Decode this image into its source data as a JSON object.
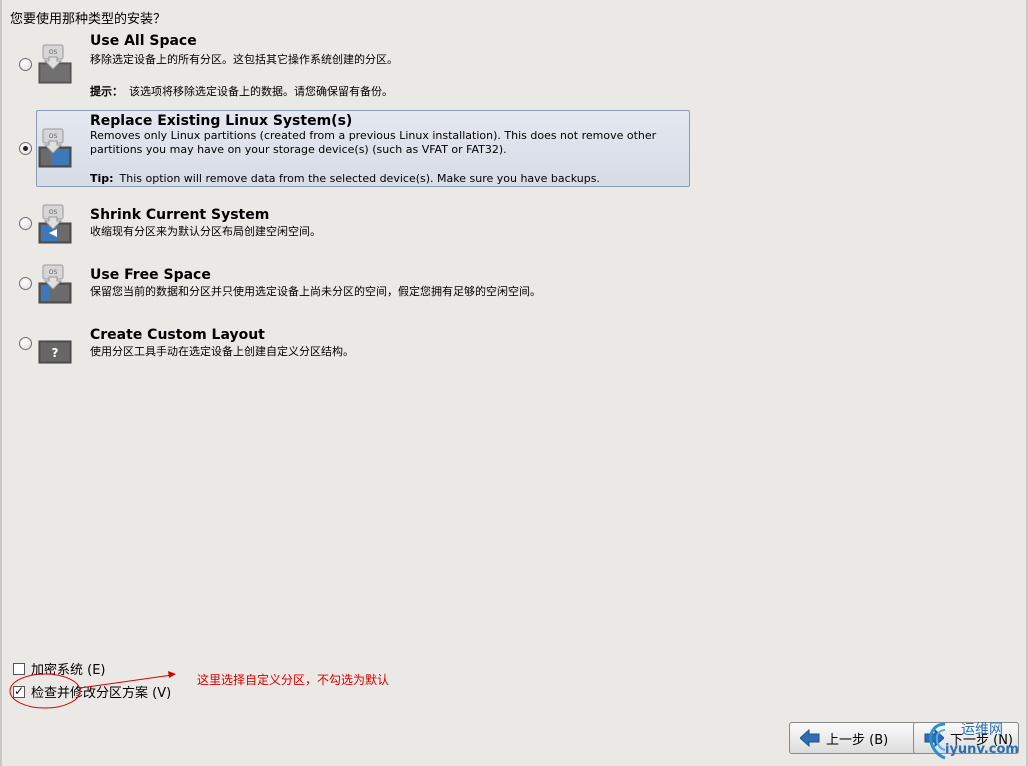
{
  "question": "您要使用那种类型的安装？",
  "options": [
    {
      "title": "Use All Space",
      "description": "移除选定设备上的所有分区。这包括其它操作系统创建的分区。",
      "tip_label": "提示：",
      "tip_text": "该选项将移除选定设备上的数据。请您确保留有备份。",
      "selected": false,
      "icon": "disk-fill-icon"
    },
    {
      "title": "Replace Existing Linux System(s)",
      "description": "Removes only Linux partitions (created from a previous Linux installation).  This does not remove other partitions you may have on your storage device(s) (such as VFAT or FAT32).",
      "tip_label": "Tip:",
      "tip_text": "This option will remove data from the selected device(s).  Make sure you have backups.",
      "selected": true,
      "icon": "disk-replace-icon"
    },
    {
      "title": "Shrink Current System",
      "description": "收缩现有分区来为默认分区布局创建空闲空间。",
      "selected": false,
      "icon": "disk-shrink-icon"
    },
    {
      "title": "Use Free Space",
      "description": "保留您当前的数据和分区并只使用选定设备上尚未分区的空间，假定您拥有足够的空闲空间。",
      "selected": false,
      "icon": "disk-free-icon"
    },
    {
      "title": "Create Custom Layout",
      "description": "使用分区工具手动在选定设备上创建自定义分区结构。",
      "selected": false,
      "icon": "question-disk-icon"
    }
  ],
  "checkboxes": {
    "encrypt": {
      "label": "加密系统 (E)",
      "checked": false
    },
    "review": {
      "label": "检查并修改分区方案 (V)",
      "checked": true
    }
  },
  "annotation": "这里选择自定义分区，不勾选为默认",
  "buttons": {
    "back": "上一步 (B)",
    "next": "下一步 (N)"
  },
  "watermark": {
    "top": "运维网",
    "bottom": "iyunv.com"
  },
  "colors": {
    "background": "#ebe9e6",
    "selected_bg": "#dde2eb",
    "annotation": "#d80000"
  }
}
